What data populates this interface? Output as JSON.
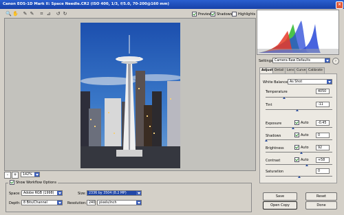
{
  "window": {
    "title": "Canon EOS-1D Mark II:  Space Needle.CR2  (ISO 400, 1/3, f/5.0, 70-200@160 mm)"
  },
  "toolbar": {
    "preview": "Preview",
    "shadows": "Shadows",
    "highlights": "Highlights"
  },
  "histogram": {
    "r": "R:",
    "g": "G:",
    "b": "B:",
    "colors": {
      "red": "#e83a2a",
      "green": "#38c02c",
      "blue": "#2848d8"
    }
  },
  "settings": {
    "label": "Settings:",
    "value": "Camera Raw Defaults"
  },
  "tabs": [
    "Adjust",
    "Detail",
    "Lens",
    "Curve",
    "Calibrate"
  ],
  "adjust": {
    "white_balance": {
      "label": "White Balance:",
      "value": "As Shot"
    },
    "temperature": {
      "label": "Temperature",
      "value": "4050"
    },
    "tint": {
      "label": "Tint",
      "value": "-11"
    },
    "exposure": {
      "label": "Exposure",
      "auto": "Auto",
      "value": "-0.45"
    },
    "shadows": {
      "label": "Shadows",
      "auto": "Auto",
      "value": "0"
    },
    "brightness": {
      "label": "Brightness",
      "auto": "Auto",
      "value": "92"
    },
    "contrast": {
      "label": "Contrast",
      "auto": "Auto",
      "value": "+58"
    },
    "saturation": {
      "label": "Saturation",
      "value": "0"
    }
  },
  "zoom": {
    "minus": "-",
    "plus": "+",
    "value": "142%"
  },
  "workflow": {
    "toggle_label": "Show Workflow Options",
    "space_label": "Space:",
    "space_value": "Adobe RGB (1998)",
    "depth_label": "Depth:",
    "depth_value": "8 Bits/Channel",
    "size_label": "Size:",
    "size_value": "2336 by 3504 (8.2 MP)",
    "resolution_label": "Resolution:",
    "resolution_value": "240",
    "resolution_unit": "pixels/inch"
  },
  "buttons": {
    "save": "Save",
    "open_copy": "Open Copy",
    "reset": "Reset",
    "done": "Done"
  }
}
